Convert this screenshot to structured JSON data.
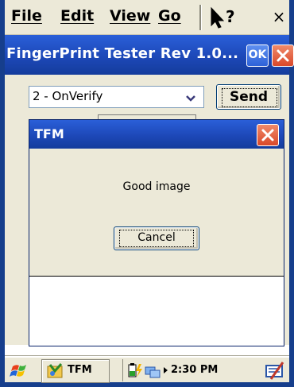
{
  "menubar": {
    "items": [
      "File",
      "Edit",
      "View",
      "Go"
    ],
    "help_icon": "whats-this-help-icon",
    "close_glyph": "×"
  },
  "window": {
    "title": "FingerPrint Tester Rev 1.0...",
    "ok_label": "OK",
    "close_icon": "close-icon"
  },
  "controls": {
    "command_select_value": "2 - OnVerify",
    "send_label": "Send"
  },
  "dialog": {
    "title": "TFM",
    "message": "Good image",
    "cancel_label": "Cancel"
  },
  "taskbar": {
    "start_icon": "windows-flag-icon",
    "task_label": "TFM",
    "clock": "2:30 PM",
    "tray_icons": [
      "battery-icon",
      "network-icon",
      "arrow-right-icon"
    ],
    "input_icon": "keyboard-icon"
  },
  "colors": {
    "titlebar_blue": "#1d48b8",
    "close_red": "#d9482a",
    "frame_blue": "#163e8c",
    "face": "#ece9d8"
  }
}
